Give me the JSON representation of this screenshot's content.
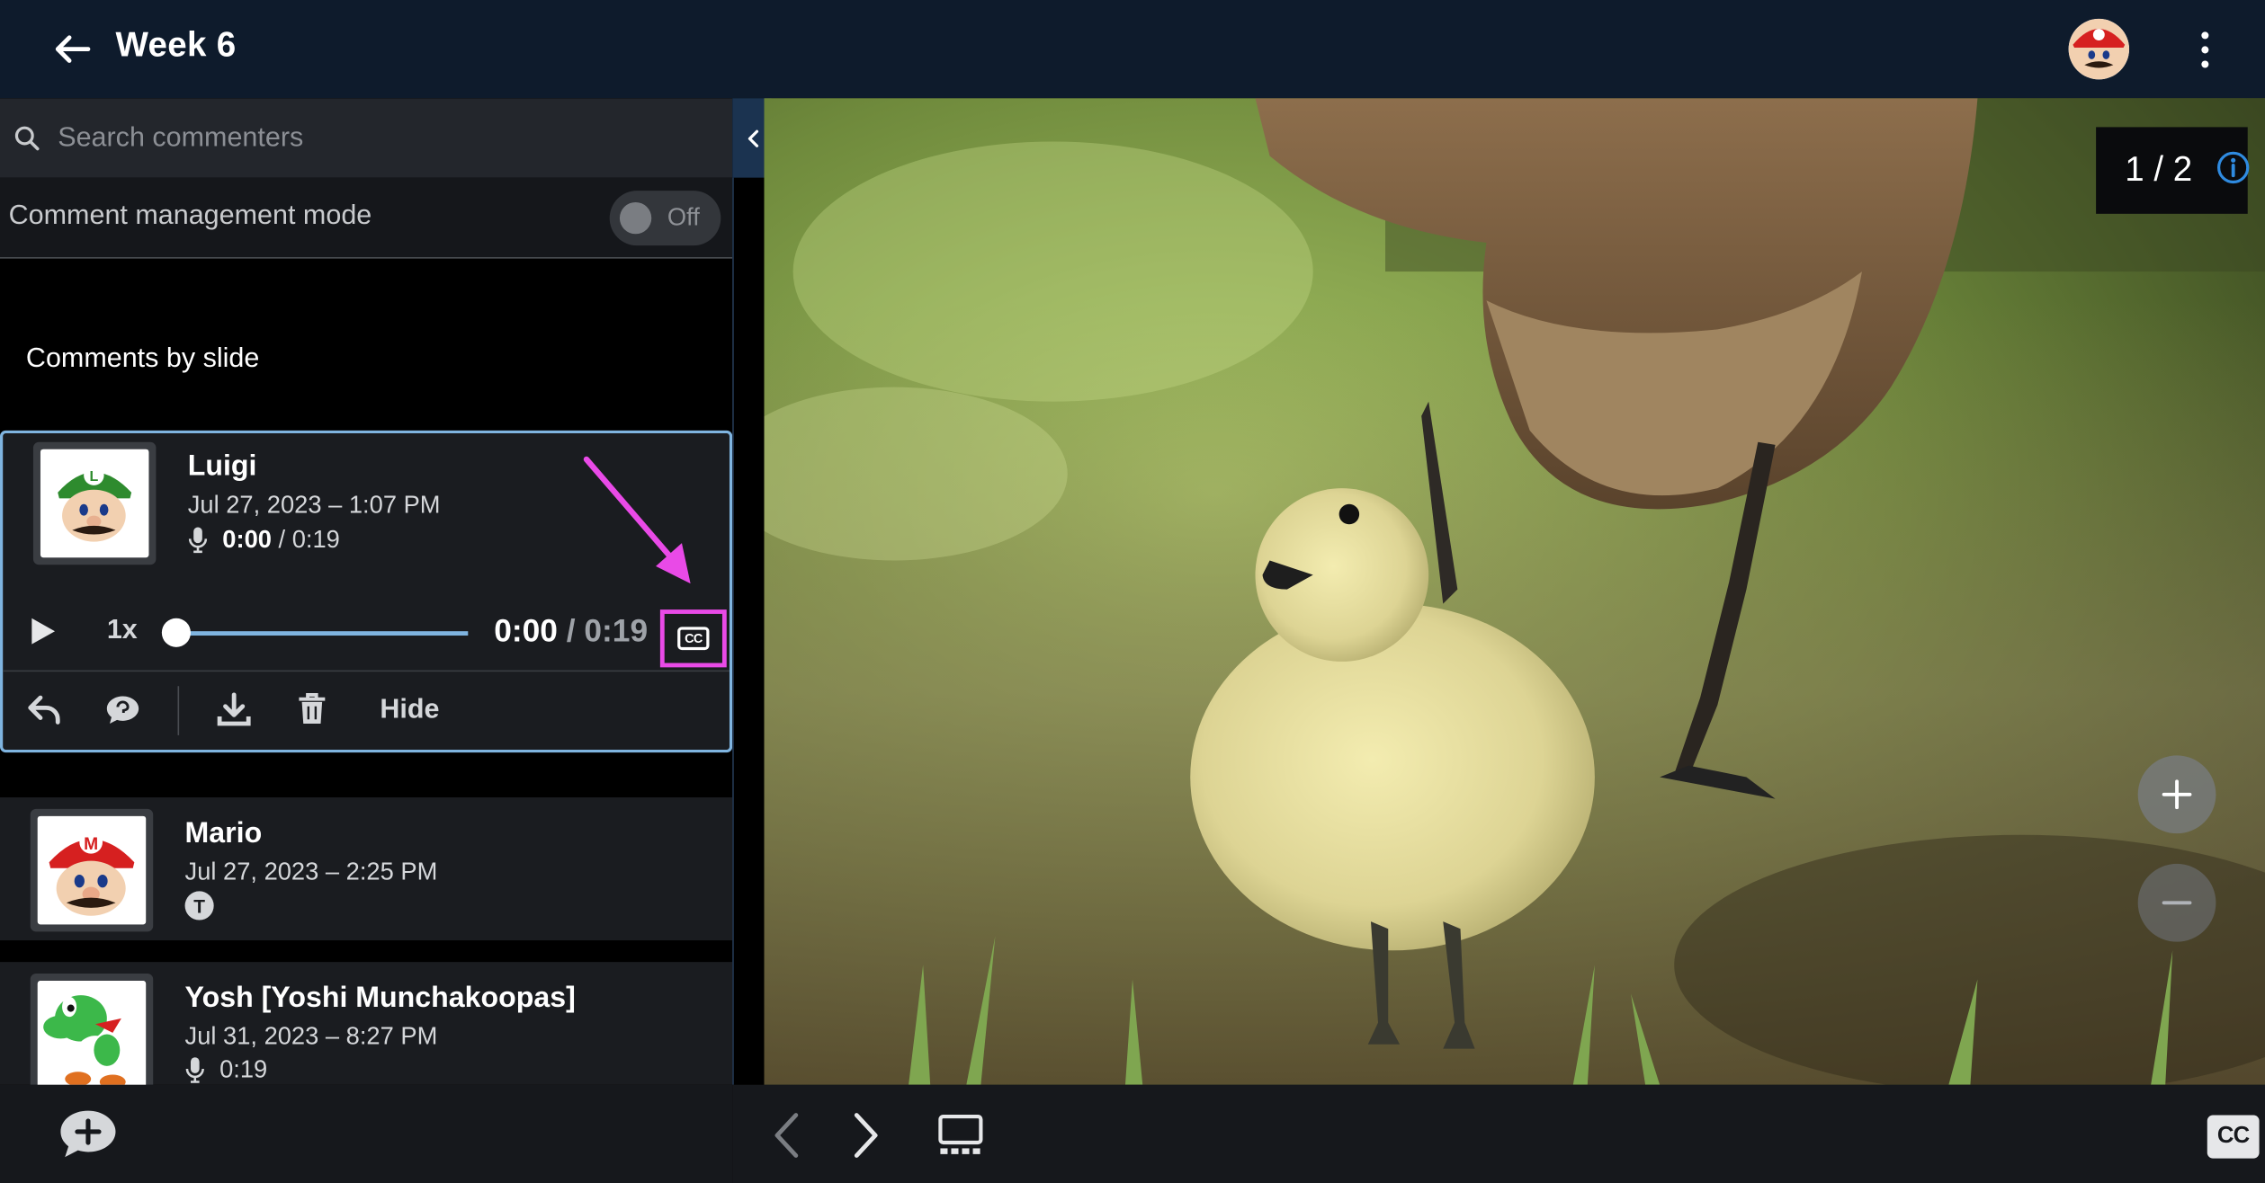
{
  "header": {
    "title": "Week 6"
  },
  "sidebar": {
    "search": {
      "placeholder": "Search commenters"
    },
    "management": {
      "label": "Comment management mode",
      "toggle_state": "Off"
    },
    "section_title": "Comments by slide",
    "comments": [
      {
        "name": "Luigi",
        "date": "Jul 27, 2023 – 1:07 PM",
        "type": "audio",
        "audio_current": "0:00",
        "audio_total": " / 0:19",
        "player": {
          "speed": "1x",
          "time_current": "0:00",
          "time_total": " / 0:19",
          "progress": 0
        },
        "actions": {
          "hide_label": "Hide"
        },
        "avatar_color": "#2e8b2e"
      },
      {
        "name": "Mario",
        "date": "Jul 27, 2023 – 2:25 PM",
        "type": "text",
        "badge": "T",
        "avatar_color": "#d62020"
      },
      {
        "name": "Yosh [Yoshi Munchakoopas]",
        "date": "Jul 31, 2023 – 8:27 PM",
        "type": "audio",
        "audio_total": "0:19",
        "avatar_color": "#3cb84a"
      }
    ]
  },
  "viewer": {
    "slide_counter": "1 / 2",
    "cc_label": "CC",
    "cc_small_label": "CC"
  },
  "colors": {
    "accent": "#7fb4e0",
    "annotation": "#e94ae7",
    "header_bg": "#0e1b2c"
  },
  "icons": [
    "back-arrow-icon",
    "kebab-menu-icon",
    "search-icon",
    "chevron-left-icon",
    "microphone-icon",
    "play-icon",
    "closed-captions-icon",
    "reply-icon",
    "comment-icon",
    "download-icon",
    "trash-icon",
    "add-comment-icon",
    "info-icon",
    "zoom-in-icon",
    "zoom-out-icon",
    "gallery-icon",
    "chevron-right-icon"
  ]
}
